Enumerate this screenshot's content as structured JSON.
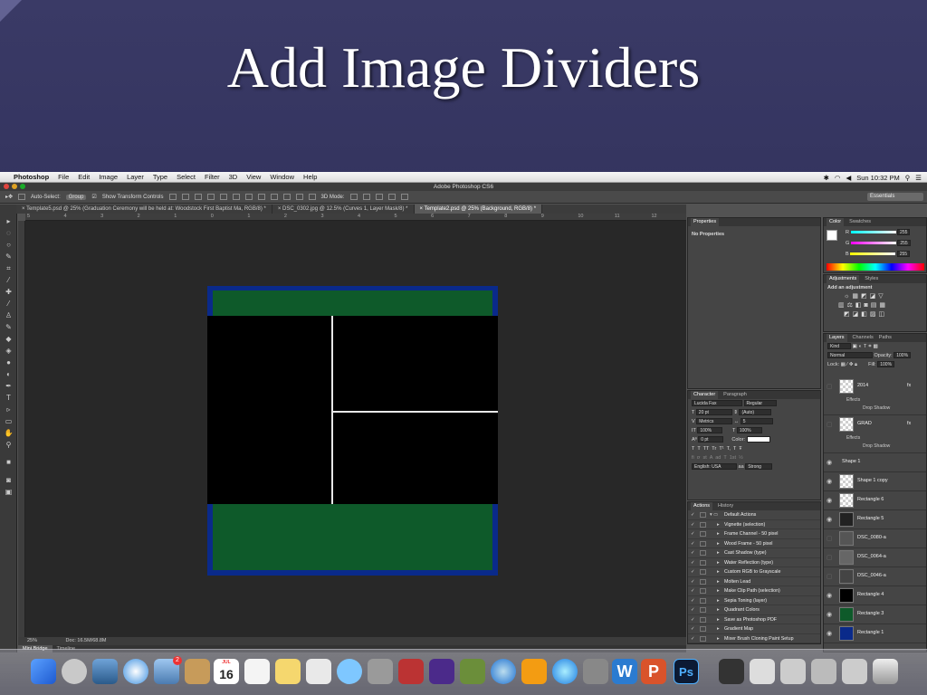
{
  "slide": {
    "title": "Add Image Dividers"
  },
  "menubar": {
    "apple": "",
    "app_name": "Photoshop",
    "items": [
      "File",
      "Edit",
      "Image",
      "Layer",
      "Type",
      "Select",
      "Filter",
      "3D",
      "View",
      "Window",
      "Help"
    ],
    "clock": "Sun 10:32 PM"
  },
  "window": {
    "title": "Adobe Photoshop CS6"
  },
  "options_bar": {
    "auto_select_label": "Auto-Select:",
    "auto_select_value": "Group",
    "show_transform_label": "Show Transform Controls",
    "mode_3d_label": "3D Mode:",
    "workspace": "Essentials"
  },
  "doc_tabs": [
    {
      "label": "Template5.psd @ 25% (Graduation Ceremony will be held at: Woodstock First Baptist Ma, RGB/8) *",
      "active": false
    },
    {
      "label": "DSC_0302.jpg @ 12.5% (Curves 1, Layer Mask/8) *",
      "active": false
    },
    {
      "label": "Template2.psd @ 25% (Background, RGB/8) *",
      "active": true
    }
  ],
  "ruler_marks": [
    "5",
    "4",
    "3",
    "2",
    "1",
    "0",
    "1",
    "2",
    "3",
    "4",
    "5",
    "6",
    "7",
    "8",
    "9",
    "10",
    "11",
    "12"
  ],
  "status": {
    "zoom": "25%",
    "doc": "Doc: 16.5M/68.8M"
  },
  "bottom_tabs": [
    "Mini Bridge",
    "Timeline"
  ],
  "properties": {
    "tab": "Properties",
    "content": "No Properties"
  },
  "color_panel": {
    "tabs": [
      "Color",
      "Swatches"
    ],
    "channels": [
      {
        "label": "R",
        "value": "255"
      },
      {
        "label": "G",
        "value": "255"
      },
      {
        "label": "B",
        "value": "255"
      }
    ]
  },
  "adjustments": {
    "tabs": [
      "Adjustments",
      "Styles"
    ],
    "header": "Add an adjustment"
  },
  "character": {
    "tabs": [
      "Character",
      "Paragraph"
    ],
    "font": "Lucida Fax",
    "style": "Regular",
    "size": "20 pt",
    "leading": "(Auto)",
    "kerning": "Metrics",
    "tracking": "5",
    "vscale": "100%",
    "hscale": "100%",
    "baseline": "0 pt",
    "color_label": "Color:",
    "language": "English: USA",
    "aa": "Strong",
    "aa_label": "aa"
  },
  "actions": {
    "tabs": [
      "Actions",
      "History"
    ],
    "set": "Default Actions",
    "items": [
      "Vignette (selection)",
      "Frame Channel - 50 pixel",
      "Wood Frame - 50 pixel",
      "Cast Shadow (type)",
      "Water Reflection (type)",
      "Custom RGB to Grayscale",
      "Molten Lead",
      "Make Clip Path (selection)",
      "Sepia Toning (layer)",
      "Quadrant Colors",
      "Save as Photoshop PDF",
      "Gradient Map",
      "Mixer Brush Cloning Paint Setup"
    ]
  },
  "layers": {
    "tabs": [
      "Layers",
      "Channels",
      "Paths"
    ],
    "kind": "Kind",
    "blend": "Normal",
    "opacity_label": "Opacity:",
    "opacity": "100%",
    "lock_label": "Lock:",
    "fill_label": "Fill:",
    "fill": "100%",
    "rows": [
      {
        "name": "2014",
        "fx": "fx",
        "effects": "Effects",
        "effect": "Drop Shadow"
      },
      {
        "name": "GRAD",
        "fx": "fx",
        "effects": "Effects",
        "effect": "Drop Shadow"
      },
      {
        "name": "Shape 1"
      },
      {
        "name": "Shape 1 copy"
      },
      {
        "name": "Rectangle 6"
      },
      {
        "name": "Rectangle 5"
      },
      {
        "name": "DSC_0080-a"
      },
      {
        "name": "DSC_0064-a"
      },
      {
        "name": "DSC_0046-a"
      },
      {
        "name": "Rectangle 4"
      },
      {
        "name": "Rectangle 3"
      },
      {
        "name": "Rectangle 1"
      }
    ]
  },
  "dock": {
    "calendar_day": "16",
    "calendar_month": "JUL",
    "badge": "2"
  },
  "colors": {
    "doc_border": "#0a2a8a",
    "doc_green": "#0e5a2a",
    "divider": "#e8e8e8"
  }
}
